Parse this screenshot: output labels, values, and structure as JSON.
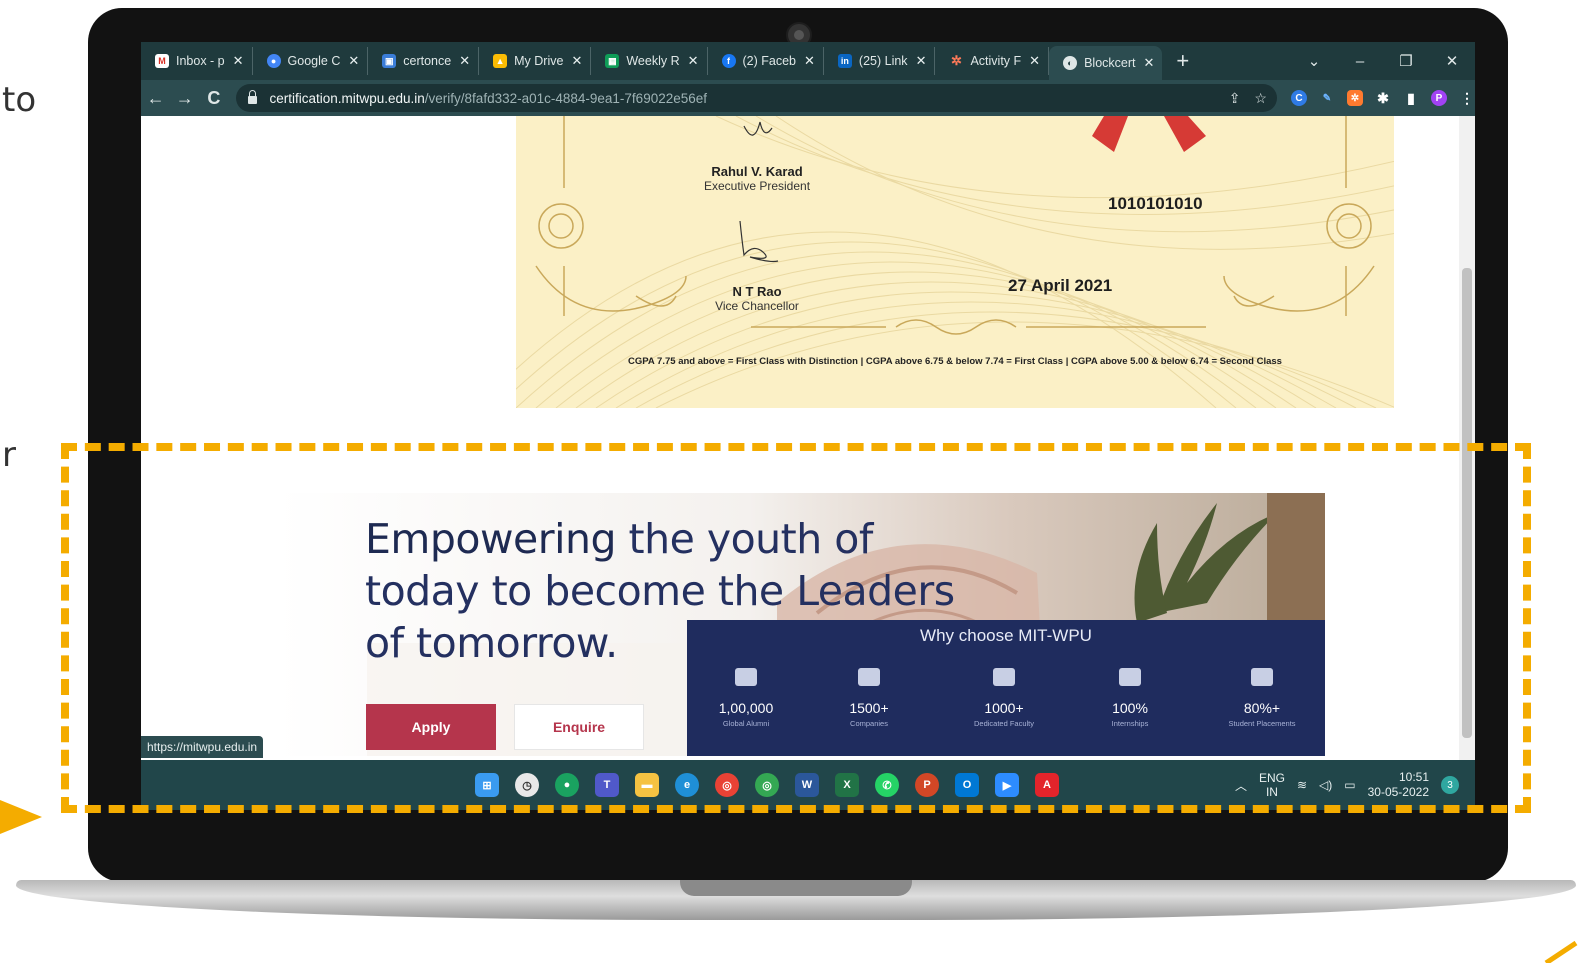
{
  "edge_text": {
    "top": "to",
    "mid": "r"
  },
  "browser": {
    "tabs": [
      {
        "label": "Inbox - p",
        "icon": "gmail-icon"
      },
      {
        "label": "Google C",
        "icon": "google-icon"
      },
      {
        "label": "certonce",
        "icon": "certonce-icon"
      },
      {
        "label": "My Drive",
        "icon": "drive-icon"
      },
      {
        "label": "Weekly R",
        "icon": "sheets-icon"
      },
      {
        "label": "(2) Faceb",
        "icon": "facebook-icon"
      },
      {
        "label": "(25) Link",
        "icon": "linkedin-icon"
      },
      {
        "label": "Activity F",
        "icon": "hubspot-icon"
      },
      {
        "label": "Blockcert",
        "icon": "globe-icon",
        "active": true
      }
    ],
    "close_glyph": "✕",
    "new_tab_glyph": "+",
    "url_host": "certification.mitwpu.edu.in",
    "url_path": "/verify/8fafd332-a01c-4884-9ea1-7f69022e56ef",
    "status_url": "https://mitwpu.edu.in"
  },
  "certificate": {
    "signatory1_name": "Rahul V. Karad",
    "signatory1_role": "Executive President",
    "signatory2_name": "N T Rao",
    "signatory2_role": "Vice Chancellor",
    "number": "1010101010",
    "date": "27 April 2021",
    "grading_note": "CGPA 7.75 and above = First Class with Distinction | CGPA above 6.75 & below 7.74 = First Class | CGPA above 5.00 & below 6.74 = Second Class"
  },
  "banner": {
    "headline_bold": "Empowering",
    "headline_rest": " the youth of",
    "headline_line2": "today to become the Leaders",
    "headline_line3": "of tomorrow.",
    "apply_label": "Apply",
    "enquire_label": "Enquire",
    "why_title": "Why choose MIT-WPU",
    "stats": [
      {
        "value": "1,00,000",
        "label": "Global Alumni"
      },
      {
        "value": "1500+",
        "label": "Companies"
      },
      {
        "value": "1000+",
        "label": "Dedicated Faculty"
      },
      {
        "value": "100%",
        "label": "Internships"
      },
      {
        "value": "80%+",
        "label": "Student Placements"
      }
    ]
  },
  "taskbar": {
    "lang_top": "ENG",
    "lang_bottom": "IN",
    "time": "10:51",
    "date": "30-05-2022",
    "notification_count": "3"
  },
  "colors": {
    "callout": "#f4ac00",
    "browser_frame": "#1f3a3d",
    "banner_navy": "#1f2c5e",
    "apply_red": "#b5354c"
  }
}
